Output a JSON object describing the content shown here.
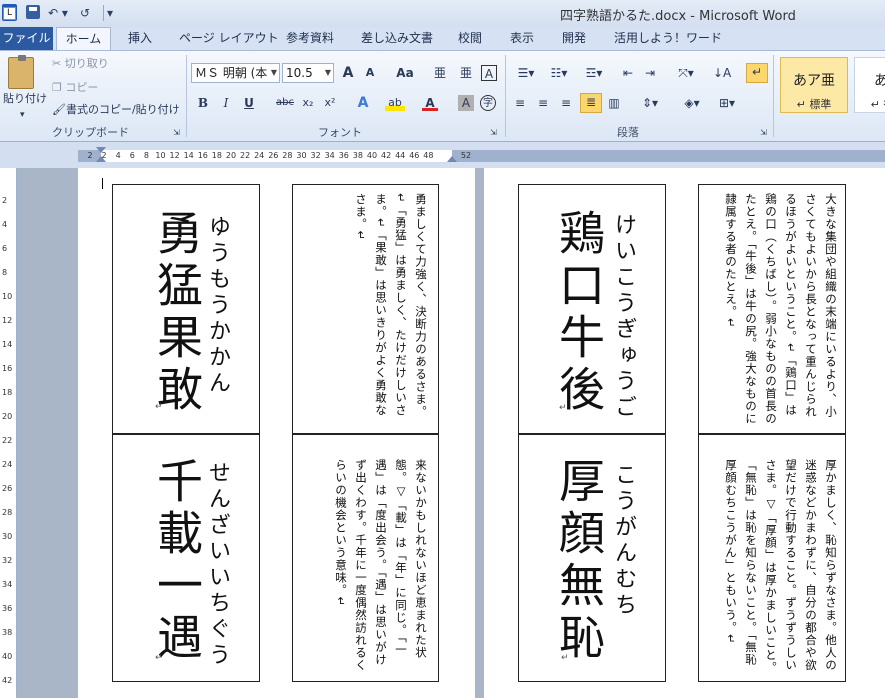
{
  "window": {
    "title": "四字熟語かるた.docx - Microsoft Word"
  },
  "quick_access": {
    "logo": "W",
    "undo": "↶ ▾",
    "redo": "↺",
    "more": "▾"
  },
  "tabs": [
    "ファイル",
    "ホーム",
    "挿入",
    "ページ レイアウト",
    "参考資料",
    "差し込み文書",
    "校閲",
    "表示",
    "開発",
    "活用しよう！ワード"
  ],
  "ribbon": {
    "clipboard": {
      "paste": "貼り付け",
      "cut": "切り取り",
      "copy": "コピー",
      "format_painter": "書式のコピー/貼り付け",
      "label": "クリップボード"
    },
    "font": {
      "name": "ＭＳ 明朝 (本",
      "size": "10.5",
      "label": "フォント",
      "buttons": [
        "A",
        "A",
        "Aa",
        "亜",
        "亜",
        "A"
      ],
      "format": [
        "B",
        "I",
        "U",
        "abc",
        "x₂",
        "x²"
      ],
      "effects": [
        "A",
        "ab",
        "A",
        "A",
        "字"
      ]
    },
    "paragraph": {
      "label": "段落"
    },
    "styles": [
      {
        "preview": "あア亜",
        "name": "↵ 標準"
      },
      {
        "preview": "あア",
        "name": "↵ 行間"
      }
    ]
  },
  "ruler": {
    "ticks": [
      "2",
      "2",
      "4",
      "6",
      "8",
      "10",
      "12",
      "14",
      "16",
      "18",
      "20",
      "22",
      "24",
      "26",
      "28",
      "30",
      "32",
      "34",
      "36",
      "38",
      "40",
      "42",
      "44",
      "46",
      "48",
      "52"
    ],
    "vticks": [
      "2",
      "4",
      "6",
      "8",
      "10",
      "12",
      "14",
      "16",
      "18",
      "20",
      "22",
      "24",
      "26",
      "28",
      "30",
      "32",
      "34",
      "36",
      "38",
      "40",
      "42"
    ]
  },
  "cards": {
    "c1": {
      "kanji": "勇猛果敢",
      "kana": "ゆうもうかかん"
    },
    "c2": {
      "kanji": "千載一遇",
      "kana": "せんざいいちぐう"
    },
    "c3": {
      "kanji": "鶏口牛後",
      "kana": "けいこうぎゅうご"
    },
    "c4": {
      "kanji": "厚顔無恥",
      "kana": "こうがんむち"
    },
    "e1": {
      "text": "勇ましくて力強く、決断力のあるさま。↵「勇猛」は勇ましく、たけだけしいさま。↵「果敢」は思いきりがよく勇敢なさま。↵"
    },
    "e2": {
      "text": "来ないかもしれないほど恵まれた状態。▽「載」は「年」に同じ。「一遇」は「度出会う。「遇」は思いがけず出くわす。千年に一度偶然訪れるくらいの機会という意味。↵"
    },
    "e3": {
      "text": "大きな集団や組織の末端にいるより、小さくてもよいから長となって重んじられるほうがよいということ。↵「鶏口」は鶏の口（くちばし）。弱小なものの首長のたとえ。「牛後」は牛の尻。強大なものに隷属する者のたとえ。↵"
    },
    "e4": {
      "text": "厚かましく、恥知らずなさま。他人の迷惑などかまわずに、自分の都合や欲望だけで行動すること。ずうずうしいさま。▽「厚顔」は厚かましいこと。「無恥」は恥を知らないこと。「無恥厚顔むちこうがん」ともいう。↵"
    }
  },
  "colors": {
    "file_tab": "#2c5aa0",
    "ribbon_bg": "#dce7f5",
    "workspace": "#a9b6c8"
  }
}
